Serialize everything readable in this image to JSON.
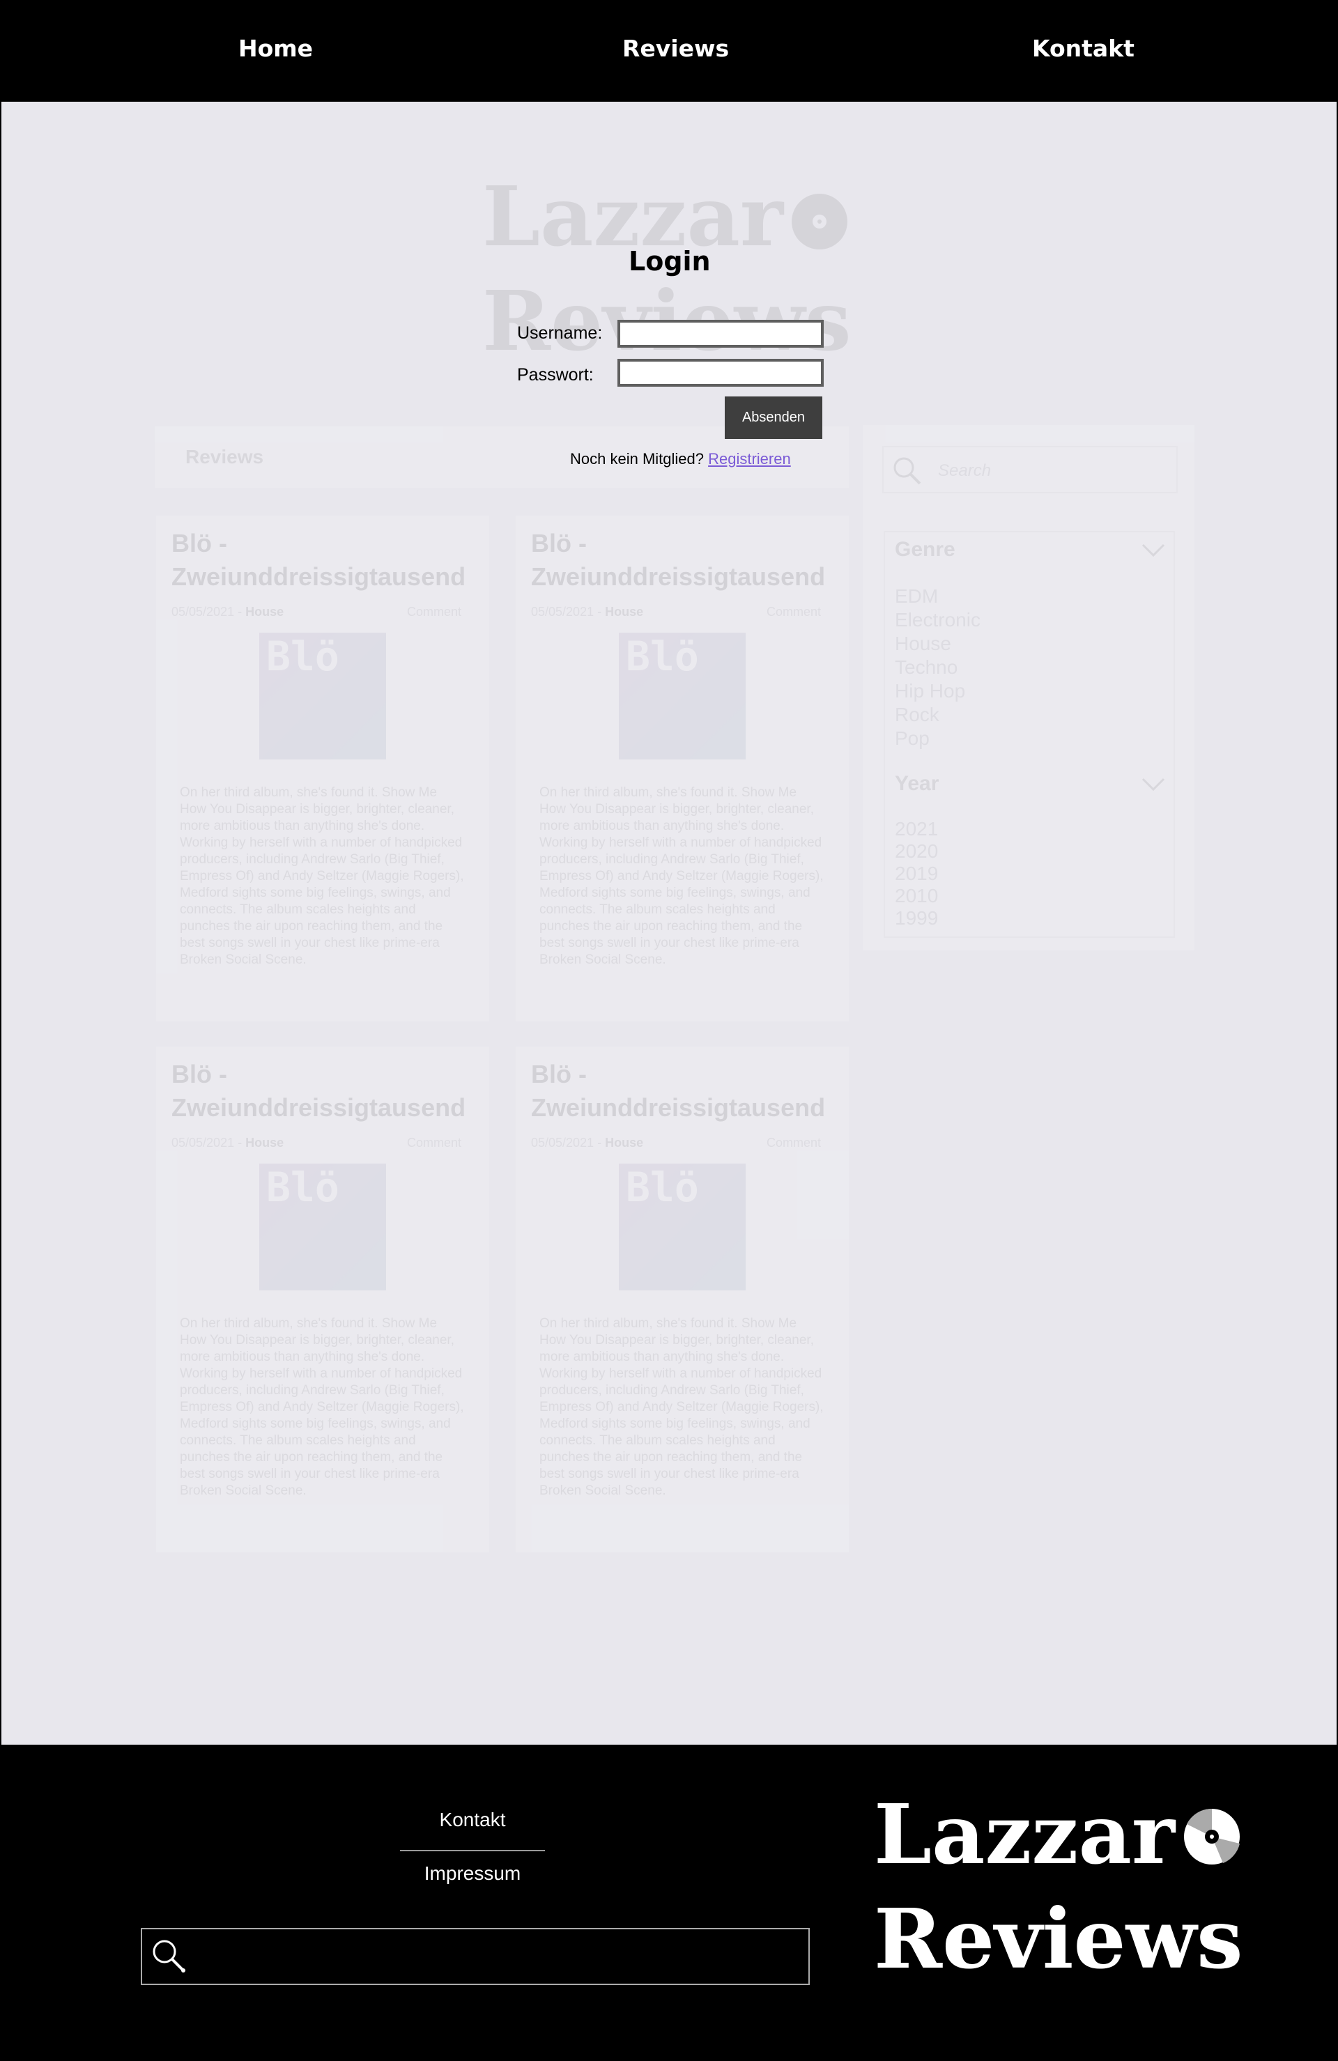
{
  "nav": {
    "home": "Home",
    "reviews": "Reviews",
    "kontakt": "Kontakt"
  },
  "brand": {
    "line1": "Lazzar",
    "line2": "Reviews"
  },
  "login": {
    "title": "Login",
    "username_label": "Username:",
    "password_label": "Passwort:",
    "username_value": "",
    "password_value": "",
    "submit_label": "Absenden",
    "register_prompt": "Noch kein Mitglied?",
    "register_link": "Registrieren"
  },
  "background": {
    "reviews_heading": "Reviews",
    "search_placeholder": "Search",
    "filters": {
      "genre_title": "Genre",
      "genres": [
        "EDM",
        "Electronic",
        "House",
        "Techno",
        "Hip Hop",
        "Rock",
        "Pop"
      ],
      "year_title": "Year",
      "years": [
        "2021",
        "2020",
        "2019",
        "2010",
        "1999"
      ]
    },
    "cards": [
      {
        "title": "Blö - Zweiunddreissigtausend",
        "date": "05/05/2021",
        "genre": "House",
        "comments": "Comment",
        "cover_text": "Blö",
        "text": "On her third album, she's found it. Show Me How You Disappear is bigger, brighter, cleaner, more ambitious than anything she's done. Working by herself with a number of handpicked producers, including Andrew Sarlo (Big Thief, Empress Of) and Andy Seltzer (Maggie Rogers), Medford sights some big feelings, swings, and connects. The album scales heights and punches the air upon reaching them, and the best songs swell in your chest like prime-era Broken Social Scene."
      },
      {
        "title": "Blö - Zweiunddreissigtausend",
        "date": "05/05/2021",
        "genre": "House",
        "comments": "Comment",
        "cover_text": "Blö",
        "text": "On her third album, she's found it. Show Me How You Disappear is bigger, brighter, cleaner, more ambitious than anything she's done. Working by herself with a number of handpicked producers, including Andrew Sarlo (Big Thief, Empress Of) and Andy Seltzer (Maggie Rogers), Medford sights some big feelings, swings, and connects. The album scales heights and punches the air upon reaching them, and the best songs swell in your chest like prime-era Broken Social Scene."
      },
      {
        "title": "Blö - Zweiunddreissigtausend",
        "date": "05/05/2021",
        "genre": "House",
        "comments": "Comment",
        "cover_text": "Blö",
        "text": "On her third album, she's found it. Show Me How You Disappear is bigger, brighter, cleaner, more ambitious than anything she's done. Working by herself with a number of handpicked producers, including Andrew Sarlo (Big Thief, Empress Of) and Andy Seltzer (Maggie Rogers), Medford sights some big feelings, swings, and connects. The album scales heights and punches the air upon reaching them, and the best songs swell in your chest like prime-era Broken Social Scene."
      },
      {
        "title": "Blö - Zweiunddreissigtausend",
        "date": "05/05/2021",
        "genre": "House",
        "comments": "Comment",
        "cover_text": "Blö",
        "text": "On her third album, she's found it. Show Me How You Disappear is bigger, brighter, cleaner, more ambitious than anything she's done. Working by herself with a number of handpicked producers, including Andrew Sarlo (Big Thief, Empress Of) and Andy Seltzer (Maggie Rogers), Medford sights some big feelings, swings, and connects. The album scales heights and punches the air upon reaching them, and the best songs swell in your chest like prime-era Broken Social Scene."
      }
    ]
  },
  "footer": {
    "kontakt": "Kontakt",
    "impressum": "Impressum",
    "search_value": ""
  },
  "colors": {
    "page_bg": "#e8e7ed",
    "bar_bg": "#000000",
    "button_bg": "#3e3e3e",
    "link": "#7b5bd6"
  },
  "icons": [
    "search-icon",
    "vinyl-record-icon",
    "chevron-down-icon"
  ]
}
